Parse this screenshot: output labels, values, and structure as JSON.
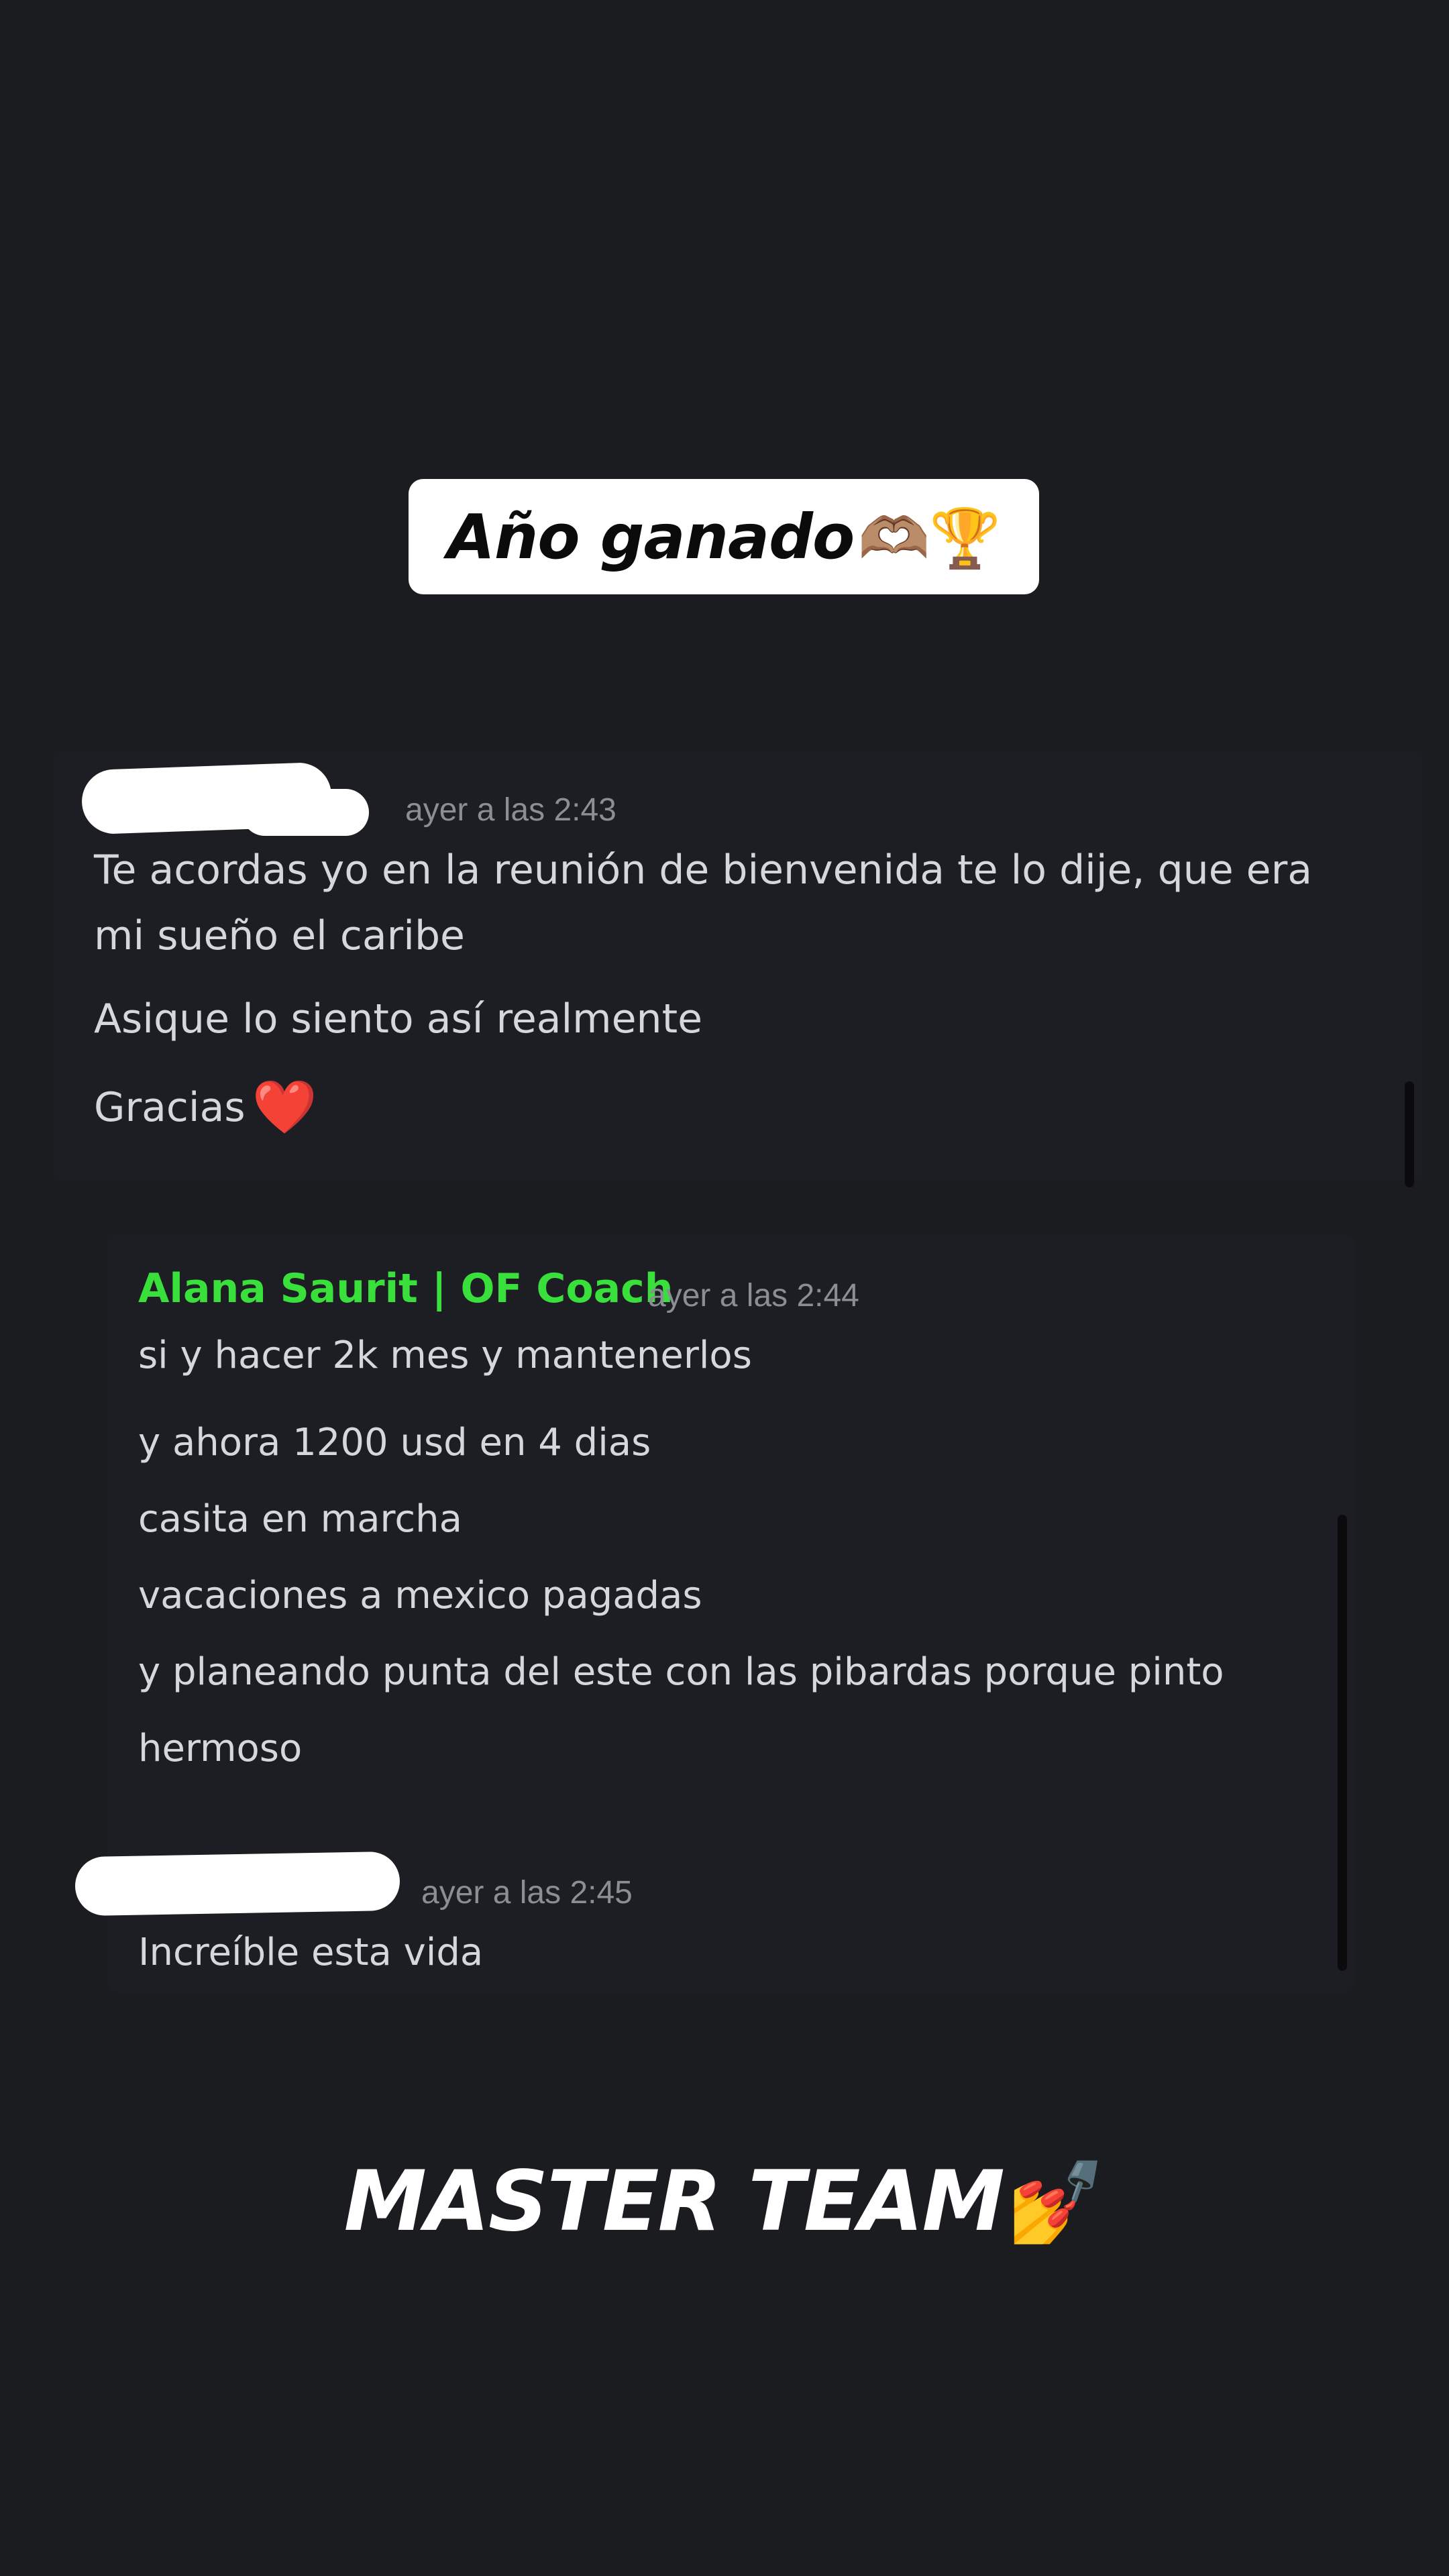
{
  "sticker": {
    "text": "Año ganado",
    "emojis": "🫶🏽🏆"
  },
  "message1": {
    "author_redacted": true,
    "timestamp": "ayer a las 2:43",
    "lines": [
      "Te acordas yo en la reunión de bienvenida te lo dije, que era",
      "mi sueño el caribe",
      "Asique lo siento así realmente",
      "Gracias"
    ],
    "heart_emoji": "❤️"
  },
  "message2": {
    "author": "Alana Saurit | OF Coach",
    "author_color": "#39e03c",
    "timestamp": "ayer a las 2:44",
    "lines": [
      "si y hacer 2k mes y mantenerlos",
      "y ahora 1200 usd en 4 dias",
      "casita en marcha",
      "vacaciones a mexico pagadas",
      "y planeando punta del este con las pibardas porque pinto",
      "hermoso"
    ]
  },
  "message3": {
    "author_redacted": true,
    "timestamp": "ayer a las 2:45",
    "lines": [
      "Increíble esta vida"
    ]
  },
  "footer": {
    "text": "MASTER TEAM",
    "emoji": "💅"
  }
}
